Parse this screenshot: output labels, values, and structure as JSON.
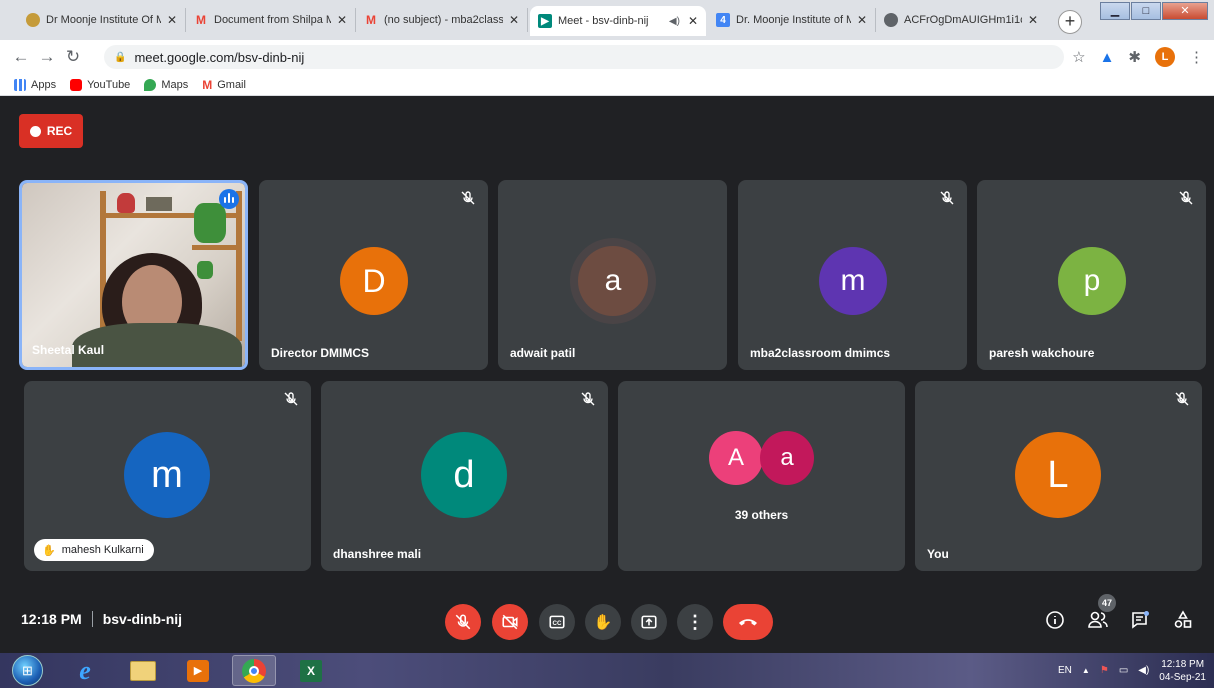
{
  "browser": {
    "tabs": [
      {
        "title": "Dr Moonje Institute Of M",
        "favicon_color": "#c59b3a",
        "favicon": "seal-icon"
      },
      {
        "title": "Document from Shilpa M",
        "favicon_color": "#ea4335",
        "favicon": "gmail-icon"
      },
      {
        "title": "(no subject) - mba2class",
        "favicon_color": "#ea4335",
        "favicon": "gmail-icon"
      },
      {
        "title": "Meet - bsv-dinb-nij",
        "favicon_color": "#00897b",
        "favicon": "meet-icon",
        "active": true
      },
      {
        "title": "Dr. Moonje Institute of M",
        "favicon_color": "#4285f4",
        "favicon": "calendar-icon"
      },
      {
        "title": "ACFrOgDmAUIGHm1i1c",
        "favicon_color": "#5f6368",
        "favicon": "globe-icon"
      }
    ],
    "url": "meet.google.com/bsv-dinb-nij",
    "profile_initial": "L",
    "bookmarks": [
      {
        "label": "Apps",
        "color": "#4285f4"
      },
      {
        "label": "YouTube",
        "color": "#ff0000"
      },
      {
        "label": "Maps",
        "color": "#34a853"
      },
      {
        "label": "Gmail",
        "color": "#ea4335"
      }
    ]
  },
  "meet": {
    "rec_label": "REC",
    "participants": [
      {
        "name": "Sheetal Kaul",
        "video": true,
        "speaking": true
      },
      {
        "name": "Director DMIMCS",
        "initial": "D",
        "color": "#e8710a"
      },
      {
        "name": "adwait patil",
        "initial": "a",
        "color": "#6d4c41"
      },
      {
        "name": "mba2classroom dmimcs",
        "initial": "m",
        "color": "#5e35b1"
      },
      {
        "name": "paresh wakchoure",
        "initial": "p",
        "color": "#7cb342"
      },
      {
        "name": "mahesh Kulkarni",
        "initial": "m",
        "color": "#1565c0",
        "hand_raised": true
      },
      {
        "name": "dhanshree mali",
        "initial": "d",
        "color": "#00897b"
      },
      {
        "name": "39 others",
        "initials": [
          "A",
          "a"
        ],
        "colors": [
          "#ec407a",
          "#c2185b"
        ]
      },
      {
        "name": "You",
        "initial": "L",
        "color": "#e8710a"
      }
    ],
    "time": "12:18 PM",
    "meeting_code": "bsv-dinb-nij",
    "people_count": "47",
    "controls": [
      "mic-off-icon",
      "camera-off-icon",
      "captions-icon",
      "raise-hand-icon",
      "present-icon",
      "more-icon",
      "hang-up-icon"
    ]
  },
  "taskbar": {
    "language": "EN",
    "clock_time": "12:18 PM",
    "clock_date": "04-Sep-21"
  }
}
